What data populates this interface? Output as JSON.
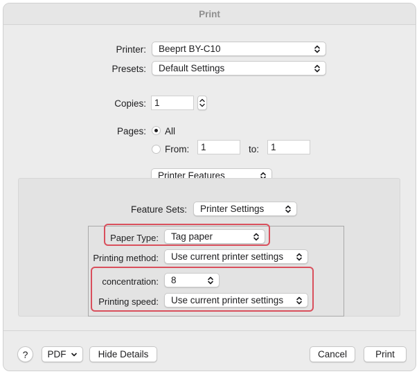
{
  "window": {
    "title": "Print"
  },
  "printer": {
    "label": "Printer:",
    "value": "Beeprt BY-C10"
  },
  "presets": {
    "label": "Presets:",
    "value": "Default Settings"
  },
  "copies": {
    "label": "Copies:",
    "value": "1"
  },
  "pages": {
    "label": "Pages:",
    "all_label": "All",
    "from_label": "From:",
    "from_value": "1",
    "to_label": "to:",
    "to_value": "1",
    "selected": "All"
  },
  "section_popup": {
    "value": "Printer Features"
  },
  "feature_sets": {
    "label": "Feature Sets:",
    "value": "Printer Settings"
  },
  "paper_type": {
    "label": "Paper Type:",
    "value": "Tag paper"
  },
  "printing_method": {
    "label": "Printing method:",
    "value": "Use current printer settings"
  },
  "concentration": {
    "label": "concentration:",
    "value": "8"
  },
  "printing_speed": {
    "label": "Printing speed:",
    "value": "Use current printer settings"
  },
  "footer": {
    "help": "?",
    "pdf": "PDF",
    "hide_details": "Hide Details",
    "cancel": "Cancel",
    "print": "Print"
  },
  "colors": {
    "highlight": "#d94f5c",
    "window_bg": "#ececec",
    "panel_bg": "#e3e3e3"
  }
}
